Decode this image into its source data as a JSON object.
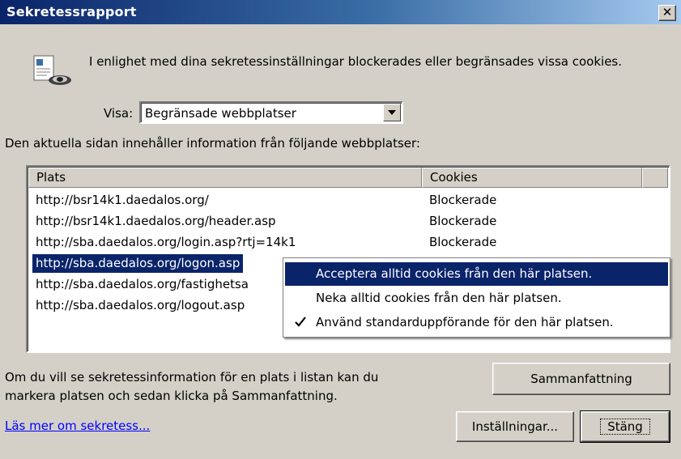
{
  "window": {
    "title": "Sekretessrapport",
    "close_label": "✕"
  },
  "intro": {
    "text": "I enlighet med dina sekretessinställningar blockerades eller begränsades vissa cookies."
  },
  "filter": {
    "label": "Visa:",
    "selected": "Begränsade webbplatser"
  },
  "description": "Den aktuella sidan innehåller information från följande webbplatser:",
  "table": {
    "columns": [
      "Plats",
      "Cookies"
    ],
    "rows": [
      {
        "url": "http://bsr14k1.daedalos.org/",
        "cookies": "Blockerade"
      },
      {
        "url": "http://bsr14k1.daedalos.org/header.asp",
        "cookies": "Blockerade"
      },
      {
        "url": "http://sba.daedalos.org/login.asp?rtj=14k1",
        "cookies": "Blockerade"
      },
      {
        "url": "http://sba.daedalos.org/logon.asp",
        "cookies": "",
        "selected": true
      },
      {
        "url": "http://sba.daedalos.org/fastighetsa",
        "cookies": ""
      },
      {
        "url": "http://sba.daedalos.org/logout.asp",
        "cookies": ""
      }
    ]
  },
  "context_menu": {
    "items": [
      {
        "label": "Acceptera alltid cookies från den här platsen.",
        "highlighted": true,
        "checked": false
      },
      {
        "label": "Neka alltid cookies från den här platsen.",
        "highlighted": false,
        "checked": false
      },
      {
        "label": "Använd standarduppförande för den här platsen.",
        "highlighted": false,
        "checked": true
      }
    ]
  },
  "info": {
    "line1": "Om du vill se sekretessinformation för en plats i listan kan du",
    "line2": "markera platsen och sedan klicka på Sammanfattning."
  },
  "buttons": {
    "summary": "Sammanfattning",
    "settings": "Inställningar...",
    "close": "Stäng"
  },
  "link": "Läs mer om sekretess...",
  "icons": {
    "privacy": "privacy-report-icon",
    "check": "checkmark-icon",
    "dropdown": "dropdown-arrow-icon"
  },
  "colors": {
    "title_start": "#0a246a",
    "title_end": "#a6caf0",
    "face": "#d4d0c8",
    "highlight": "#0a246a",
    "link": "#0000ff"
  }
}
